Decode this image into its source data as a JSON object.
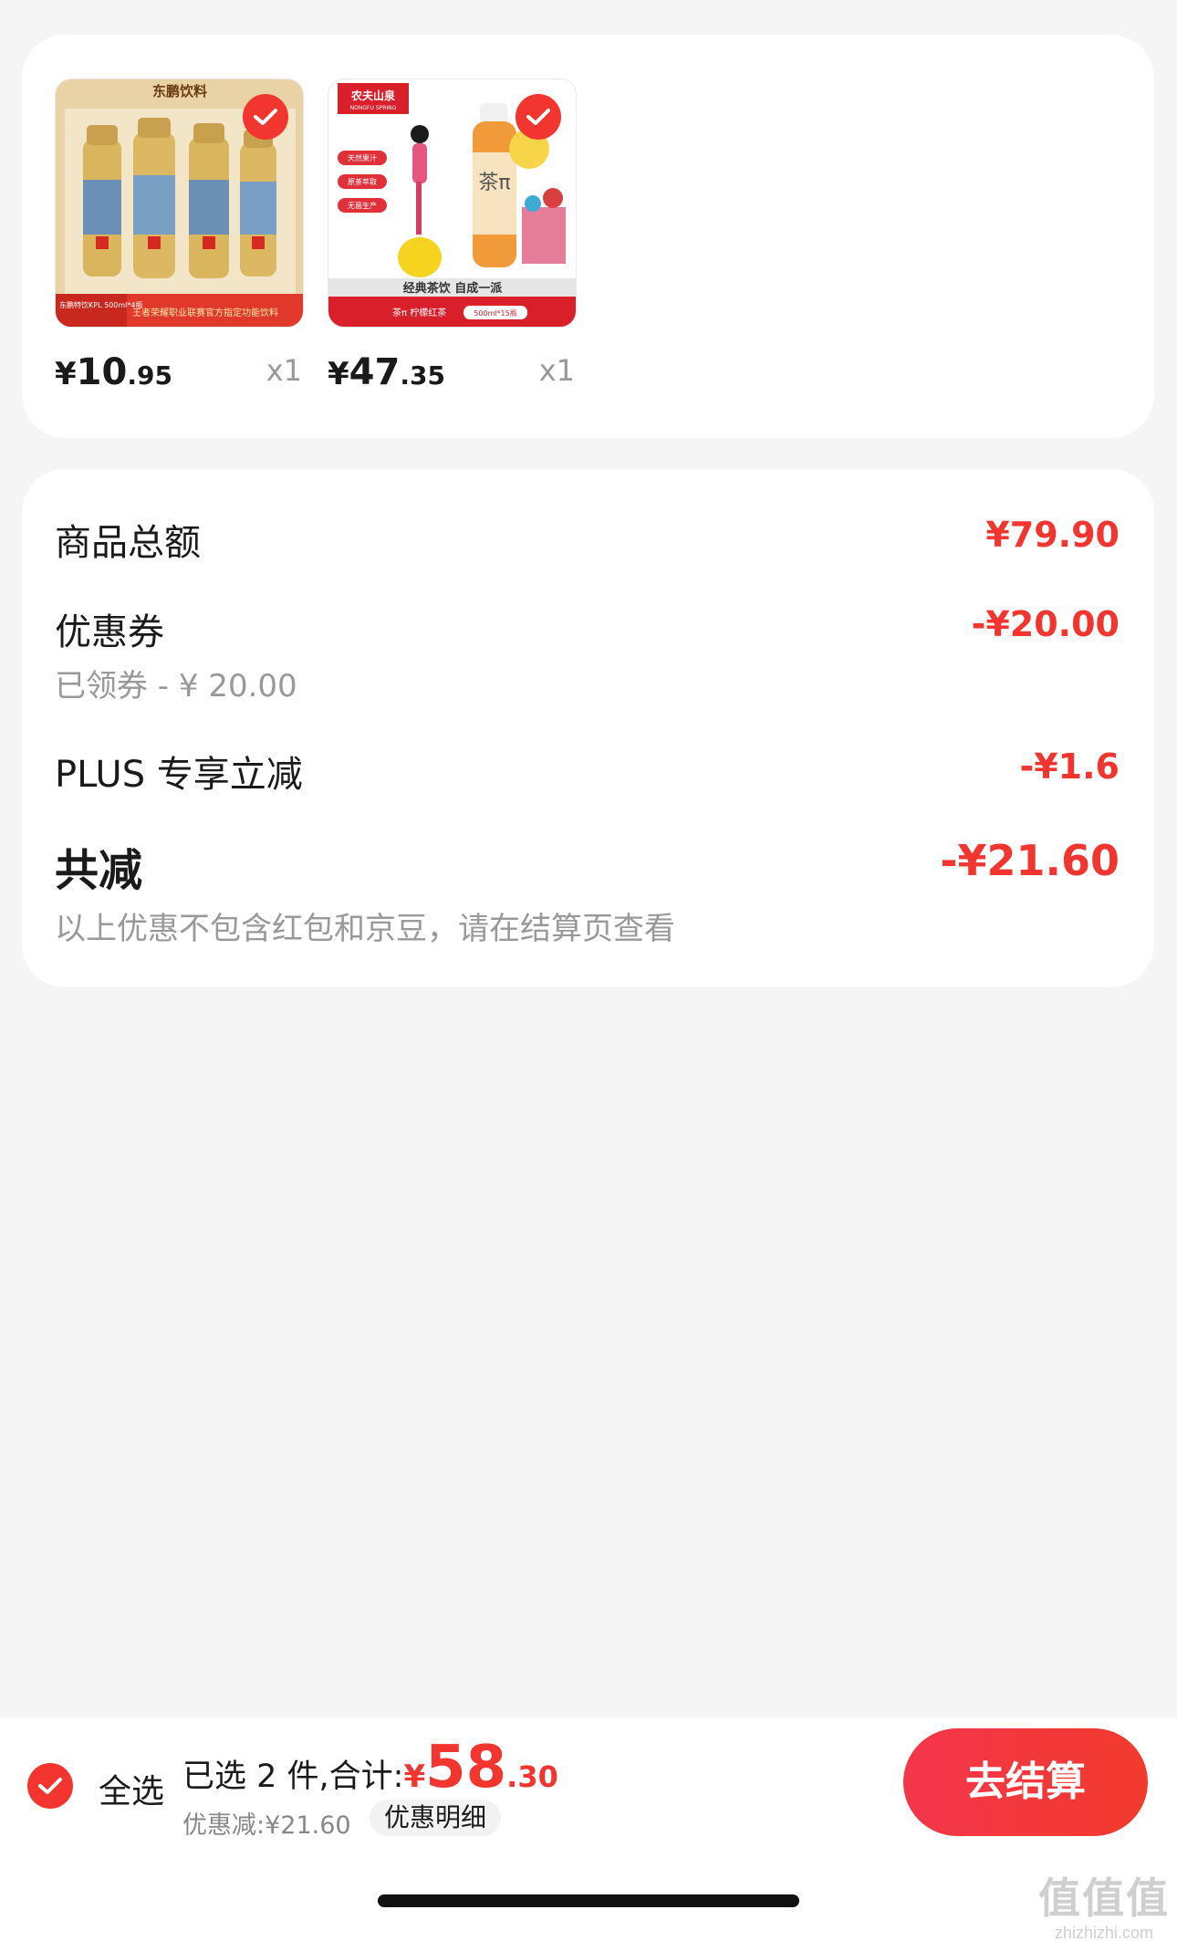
{
  "products": [
    {
      "image_brand": "东鹏饮料",
      "image_tag": "东鹏特饮KPL 500ml*4瓶",
      "image_banner": "王者荣耀职业联赛官方指定功能饮料",
      "price_currency": "¥",
      "price_integer": "10",
      "price_decimal": ".95",
      "quantity": "x1",
      "selected": true
    },
    {
      "image_brand": "农夫山泉",
      "image_brand_en": "NONGFU SPRING",
      "image_tags": [
        "天然果汁",
        "原茶萃取",
        "无菌生产"
      ],
      "image_slogan": "经典茶饮 自成一派",
      "image_footer": "茶π 柠檬红茶",
      "image_spec": "500ml*15瓶",
      "image_bottle_text": "茶π",
      "price_currency": "¥",
      "price_integer": "47",
      "price_decimal": ".35",
      "quantity": "x1",
      "selected": true
    }
  ],
  "summary": {
    "goods_total_label": "商品总额",
    "goods_total_value": "¥79.90",
    "coupon_label": "优惠券",
    "coupon_value": "-¥20.00",
    "coupon_sub": "已领券 - ¥ 20.00",
    "plus_label": "PLUS 专享立减",
    "plus_value": "-¥1.6",
    "total_reduce_label": "共减",
    "total_reduce_value": "-¥21.60",
    "note": "以上优惠不包含红包和京豆，请在结算页查看"
  },
  "bottom_bar": {
    "select_all_label": "全选",
    "selected_text": "已选 2 件,合计:",
    "total_currency": "¥",
    "total_integer": "58",
    "total_decimal": ".30",
    "discount_text": "优惠减:¥21.60",
    "discount_detail_label": "优惠明细",
    "checkout_label": "去结算"
  },
  "watermark": {
    "main": "值值值",
    "sub": "zhizhizhi.com"
  },
  "colors": {
    "accent": "#f2352e",
    "background": "#f5f5f5"
  }
}
